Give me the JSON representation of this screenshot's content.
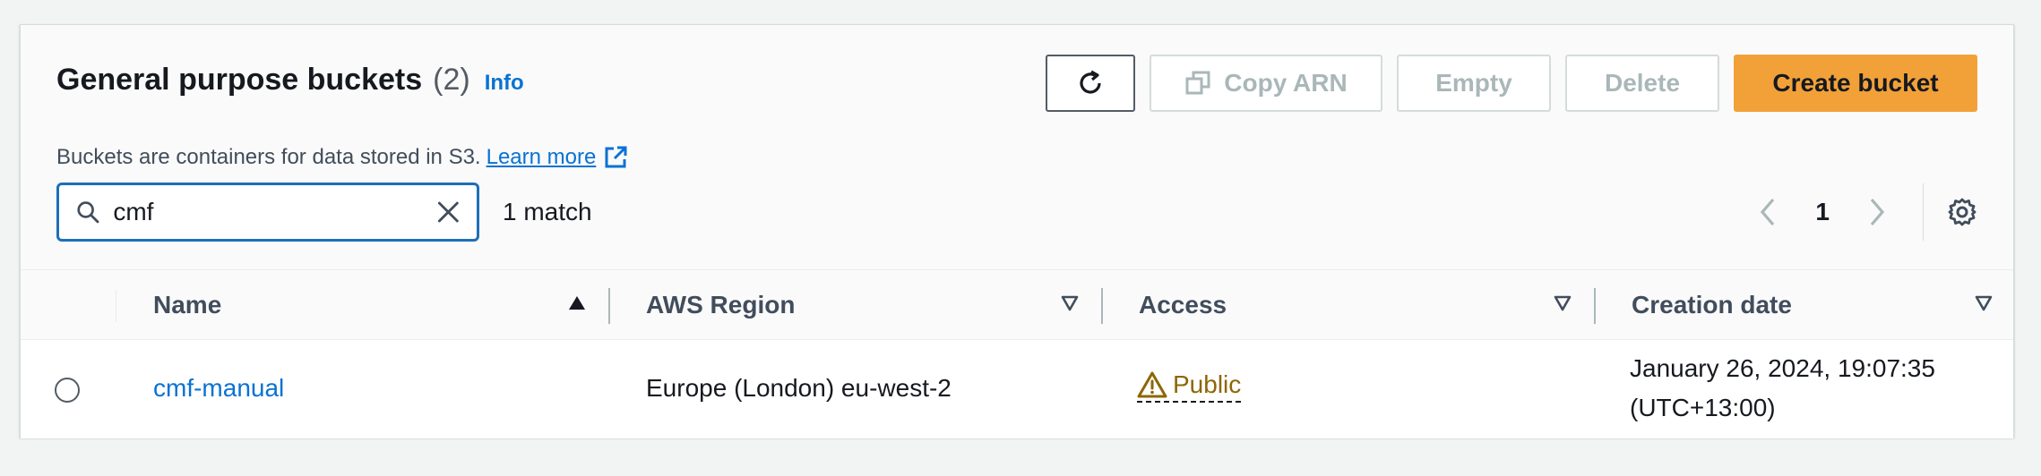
{
  "header": {
    "title": "General purpose buckets",
    "count": "(2)",
    "info_label": "Info",
    "description": "Buckets are containers for data stored in S3.",
    "learn_more_label": "Learn more"
  },
  "actions": {
    "refresh_icon": "refresh-icon",
    "copy_arn_label": "Copy ARN",
    "empty_label": "Empty",
    "delete_label": "Delete",
    "create_bucket_label": "Create bucket"
  },
  "search": {
    "value": "cmf",
    "match_text": "1 match"
  },
  "pagination": {
    "current_page": "1"
  },
  "table": {
    "columns": [
      {
        "label": "Name",
        "sort": "ascending"
      },
      {
        "label": "AWS Region",
        "sort": "none"
      },
      {
        "label": "Access",
        "sort": "none"
      },
      {
        "label": "Creation date",
        "sort": "none"
      }
    ],
    "rows": [
      {
        "name": "cmf-manual",
        "region": "Europe (London) eu-west-2",
        "access": "Public",
        "creation_date_line1": "January 26, 2024, 19:07:35",
        "creation_date_line2": "(UTC+13:00)"
      }
    ]
  },
  "colors": {
    "primary_button": "#f2a138",
    "link": "#0972d3",
    "warning": "#8d6605",
    "focus_border": "#1d6fb8"
  }
}
